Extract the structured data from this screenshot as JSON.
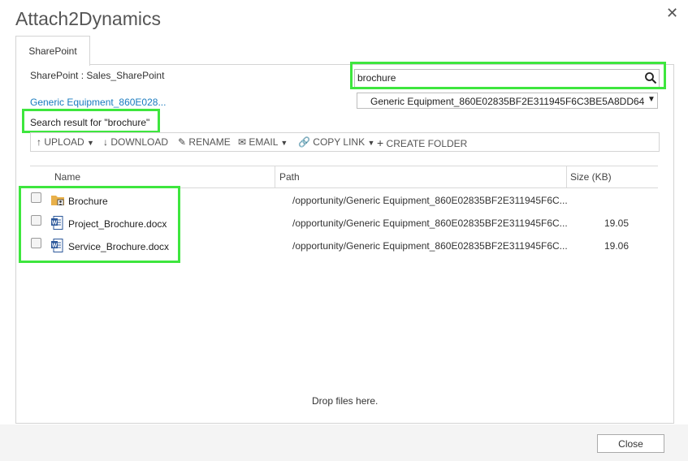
{
  "dialog": {
    "title": "Attach2Dynamics"
  },
  "tabs": [
    {
      "label": "SharePoint"
    }
  ],
  "sharepoint": {
    "site_label": "SharePoint : Sales_SharePoint",
    "folder_link": "Generic Equipment_860E028..."
  },
  "search": {
    "value": "brochure"
  },
  "library_select": {
    "value": "Generic Equipment_860E02835BF2E311945F6C3BE5A8DD64"
  },
  "search_result_label": "Search result for \"brochure\"",
  "toolbar": {
    "upload": "UPLOAD",
    "download": "DOWNLOAD",
    "rename": "RENAME",
    "email": "EMAIL",
    "copy_link": "COPY LINK",
    "create_folder": "CREATE FOLDER"
  },
  "table": {
    "headers": {
      "name": "Name",
      "path": "Path",
      "size": "Size (KB)"
    },
    "rows": [
      {
        "name": "Brochure",
        "type": "folder",
        "path": "/opportunity/Generic Equipment_860E02835BF2E311945F6C...",
        "size": ""
      },
      {
        "name": "Project_Brochure.docx",
        "type": "word",
        "path": "/opportunity/Generic Equipment_860E02835BF2E311945F6C...",
        "size": "19.05"
      },
      {
        "name": "Service_Brochure.docx",
        "type": "word",
        "path": "/opportunity/Generic Equipment_860E02835BF2E311945F6C...",
        "size": "19.06"
      }
    ]
  },
  "drop_hint": "Drop files here.",
  "footer": {
    "close_label": "Close"
  },
  "colors": {
    "highlight": "#3ee63e",
    "link": "#1a7bbf",
    "word_blue": "#2b579a",
    "folder": "#e8b04a"
  }
}
